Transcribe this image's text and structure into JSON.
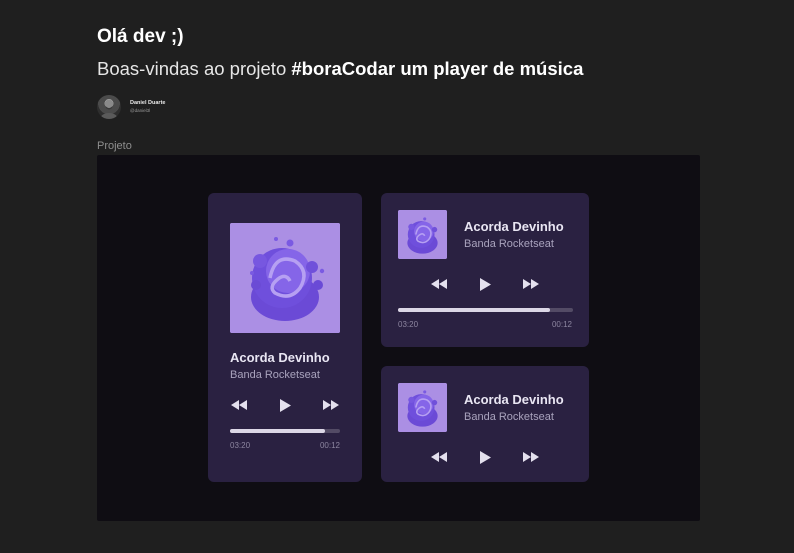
{
  "header": {
    "greeting": "Olá dev ;)",
    "subtitle_prefix": "Boas-vindas ao projeto ",
    "subtitle_highlight": "#boraCodar um player de música"
  },
  "author": {
    "name": "Daniel Duarte",
    "handle": "@daniel3l"
  },
  "section_label": "Projeto",
  "colors": {
    "page_bg": "#1f1f1f",
    "canvas_bg": "#0f0d13",
    "card_bg": "#2a2141",
    "cover_bg": "#a88be0",
    "accent": "#6c4bd8",
    "progress_track": "#534b65",
    "progress_fill": "#dcd7e6"
  },
  "players": [
    {
      "variant": "tall",
      "title": "Acorda Devinho",
      "artist": "Banda Rocketseat",
      "time_total": "03:20",
      "time_elapsed": "00:12",
      "progress": 0.86,
      "controls": [
        "rewind-icon",
        "play-icon",
        "fast-forward-icon"
      ]
    },
    {
      "variant": "compact",
      "title": "Acorda Devinho",
      "artist": "Banda Rocketseat",
      "time_total": "03:20",
      "time_elapsed": "00:12",
      "progress": 0.87,
      "controls": [
        "rewind-icon",
        "play-icon",
        "fast-forward-icon"
      ]
    },
    {
      "variant": "mini",
      "title": "Acorda Devinho",
      "artist": "Banda Rocketseat",
      "controls": [
        "rewind-icon",
        "play-icon",
        "fast-forward-icon"
      ]
    }
  ]
}
